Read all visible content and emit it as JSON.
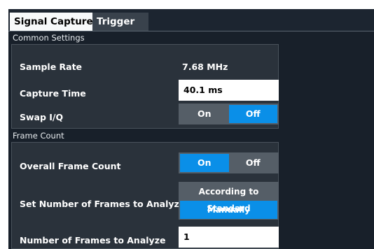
{
  "tabs": [
    {
      "label": "Signal Capture",
      "active": true
    },
    {
      "label": "Trigger",
      "active": false
    }
  ],
  "common_settings": {
    "title": "Common Settings",
    "sample_rate": {
      "label": "Sample Rate",
      "value": "7.68 MHz"
    },
    "capture_time": {
      "label": "Capture Time",
      "value": "40.1 ms"
    },
    "swap_iq": {
      "label": "Swap I/Q",
      "options": [
        "On",
        "Off"
      ],
      "selected": "Off"
    }
  },
  "frame_count": {
    "title": "Frame Count",
    "overall": {
      "label": "Overall Frame Count",
      "options": [
        "On",
        "Off"
      ],
      "selected": "On"
    },
    "set_number": {
      "label": "Set Number of Frames to Analyze",
      "options": [
        "According to Standard",
        "Manually"
      ],
      "selected": "Manually"
    },
    "number": {
      "label": "Number of Frames to Analyze",
      "value": "1"
    }
  },
  "colors": {
    "accent": "#0a8fe8",
    "panel_bg": "#18202a",
    "group_bg": "#2a323b",
    "toggle_bg": "#555e67"
  }
}
